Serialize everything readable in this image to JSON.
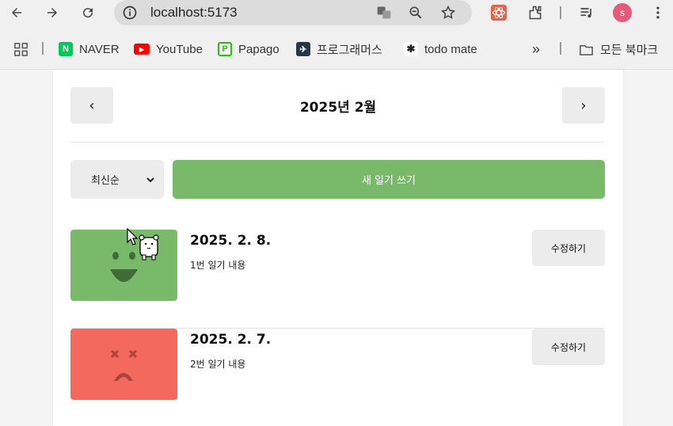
{
  "browser": {
    "url": "localhost:5173",
    "avatar_letter": "s",
    "bookmarks": [
      {
        "label": "NAVER",
        "icon": "naver-icon",
        "color": "#03c75a",
        "glyph": "N"
      },
      {
        "label": "YouTube",
        "icon": "youtube-icon",
        "color": "#ff0000",
        "glyph": "▶"
      },
      {
        "label": "Papago",
        "icon": "papago-icon",
        "color": "#1ec800",
        "glyph": "P"
      },
      {
        "label": "프로그래머스",
        "icon": "programmers-icon",
        "color": "#263747",
        "glyph": "✈"
      },
      {
        "label": "todo mate",
        "icon": "todo-mate-icon",
        "color": "#222222",
        "glyph": "✱"
      }
    ],
    "more_label": "»",
    "all_bookmarks_label": "모든 북마크"
  },
  "header": {
    "title": "2025년 2월",
    "prev_label": "‹",
    "next_label": "›"
  },
  "toolbar": {
    "sort_value": "최신순",
    "new_button_label": "새 일기 쓰기",
    "accent_color": "#78ba69"
  },
  "entries": [
    {
      "date": "2025. 2. 8.",
      "content": "1번 일기 내용",
      "edit_label": "수정하기",
      "emotion": "happy",
      "color": "#78ba69"
    },
    {
      "date": "2025. 2. 7.",
      "content": "2번 일기 내용",
      "edit_label": "수정하기",
      "emotion": "angry",
      "color": "#f4695e"
    }
  ]
}
